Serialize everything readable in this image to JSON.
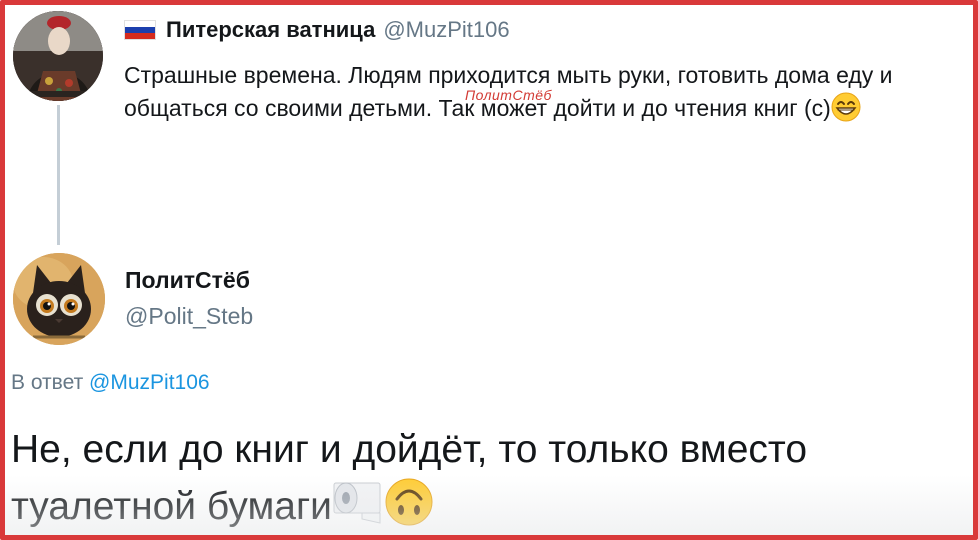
{
  "parent_tweet": {
    "flag_colors": [
      "#ffffff",
      "#1c3fae",
      "#d52b1e"
    ],
    "author_name": "Питерская ватница",
    "author_handle": "@MuzPit106",
    "text": "Страшные времена. Людям приходится мыть руки, готовить дома еду и общаться со своими детьми. Так может дойти и до чтения книг (с)",
    "emoji": "grinning-face-with-smiling-eyes-icon",
    "watermark": "ПолитСтёб"
  },
  "reply_tweet": {
    "author_name": "ПолитСтёб",
    "author_handle": "@Polit_Steb",
    "reply_prefix": "В ответ",
    "reply_to_handle": "@MuzPit106",
    "text": "Не, если до книг и дойдёт, то только вместо туалетной бумаги",
    "emojis": [
      "toilet-paper-icon",
      "upside-down-face-icon"
    ]
  },
  "colors": {
    "frame_border": "#d9393a",
    "link": "#1b95e0",
    "secondary_text": "#657786",
    "thread_line": "#c4ced6"
  }
}
